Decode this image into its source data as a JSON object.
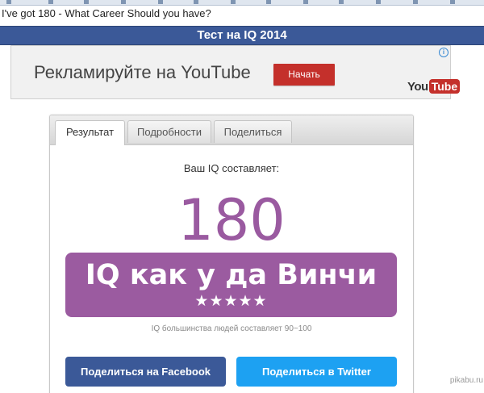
{
  "window": {
    "title": "I've got 180 - What Career Should you have?"
  },
  "header": {
    "title": "Тест на IQ 2014",
    "background_color": "#3b5998"
  },
  "ad": {
    "text": "Рекламируйте на YouTube",
    "button_label": "Начать",
    "button_color": "#c4302b",
    "info_icon": "info-icon",
    "logo_you": "You",
    "logo_tube": "Tube"
  },
  "tabs": [
    {
      "label": "Результат",
      "active": true
    },
    {
      "label": "Подробности",
      "active": false
    },
    {
      "label": "Поделиться",
      "active": false
    }
  ],
  "result": {
    "label": "Ваш IQ составляет:",
    "score": "180",
    "title": "IQ как у да Винчи",
    "stars_count": 5,
    "stars": "★★★★★",
    "note": "IQ большинства людей составляет 90~100",
    "accent_color": "#9a5aa0"
  },
  "share": {
    "facebook_label": "Поделиться на Facebook",
    "facebook_color": "#3b5998",
    "twitter_label": "Поделиться в Twitter",
    "twitter_color": "#1da1f2"
  },
  "watermark": {
    "text": "pikabu.ru"
  }
}
